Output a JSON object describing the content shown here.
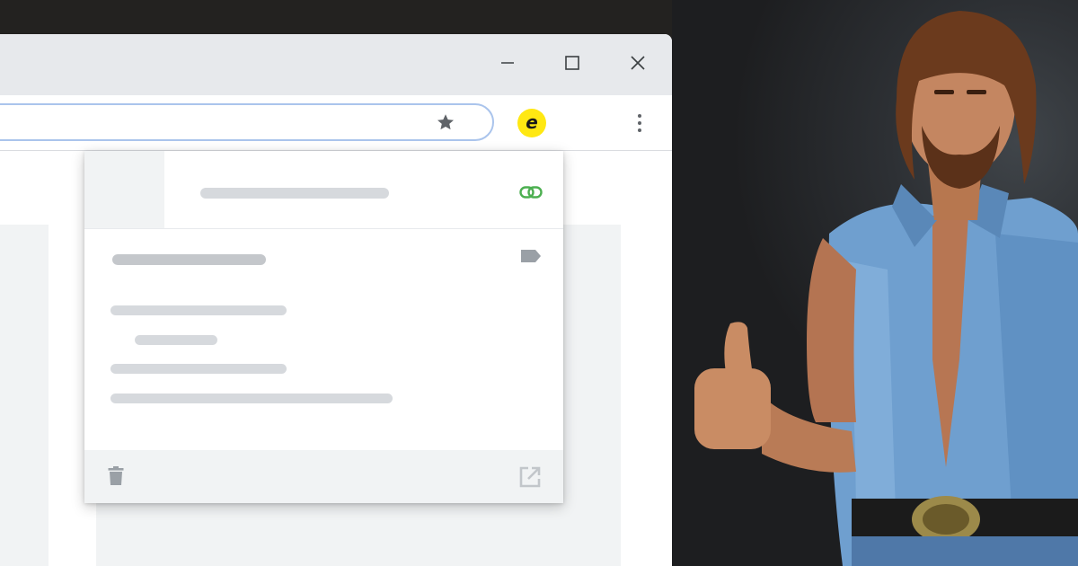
{
  "browser": {
    "window_controls": [
      {
        "name": "minimize-button",
        "icon": "minimize-icon"
      },
      {
        "name": "maximize-button",
        "icon": "maximize-icon"
      },
      {
        "name": "close-button",
        "icon": "close-icon"
      }
    ],
    "address_bar": {
      "value": "",
      "placeholder": ""
    },
    "bookmark_icon": "star-icon",
    "extension": {
      "label": "e",
      "color": "#ffe812"
    },
    "menu_icon": "more-vert-icon"
  },
  "popup": {
    "link_icon": "link-icon",
    "tag_icon": "label-icon",
    "delete_icon": "trash-icon",
    "open_icon": "open-in-new-icon",
    "accent_color": "#4caf50"
  },
  "colors": {
    "titlebar": "#e7e9ec",
    "omnibox_border": "#aac4ec",
    "placeholder_bar": "#d6d9dd",
    "icon_gray": "#9aa0a6"
  }
}
